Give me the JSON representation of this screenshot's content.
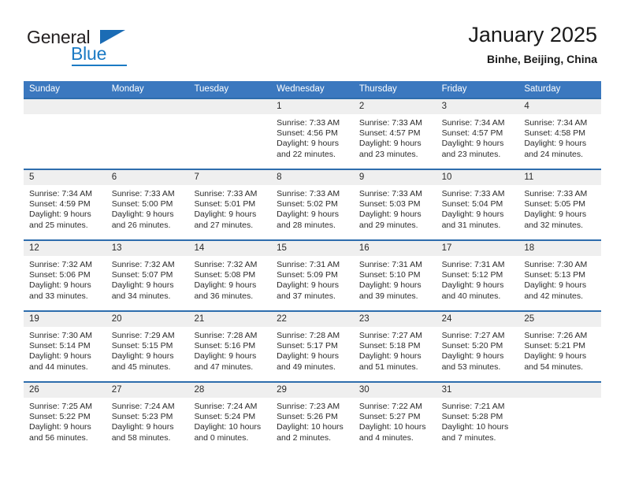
{
  "brand": {
    "name_part1": "General",
    "name_part2": "Blue"
  },
  "header": {
    "title": "January 2025",
    "location": "Binhe, Beijing, China"
  },
  "colors": {
    "header_blue": "#3b78bf",
    "row_divider_blue": "#2e6dad",
    "daynum_band": "#efefef",
    "brand_blue": "#1b7ac4"
  },
  "weekdays": [
    "Sunday",
    "Monday",
    "Tuesday",
    "Wednesday",
    "Thursday",
    "Friday",
    "Saturday"
  ],
  "weeks": [
    [
      {
        "day": "",
        "sunrise": "",
        "sunset": "",
        "daylight": ""
      },
      {
        "day": "",
        "sunrise": "",
        "sunset": "",
        "daylight": ""
      },
      {
        "day": "",
        "sunrise": "",
        "sunset": "",
        "daylight": ""
      },
      {
        "day": "1",
        "sunrise": "Sunrise: 7:33 AM",
        "sunset": "Sunset: 4:56 PM",
        "daylight": "Daylight: 9 hours and 22 minutes."
      },
      {
        "day": "2",
        "sunrise": "Sunrise: 7:33 AM",
        "sunset": "Sunset: 4:57 PM",
        "daylight": "Daylight: 9 hours and 23 minutes."
      },
      {
        "day": "3",
        "sunrise": "Sunrise: 7:34 AM",
        "sunset": "Sunset: 4:57 PM",
        "daylight": "Daylight: 9 hours and 23 minutes."
      },
      {
        "day": "4",
        "sunrise": "Sunrise: 7:34 AM",
        "sunset": "Sunset: 4:58 PM",
        "daylight": "Daylight: 9 hours and 24 minutes."
      }
    ],
    [
      {
        "day": "5",
        "sunrise": "Sunrise: 7:34 AM",
        "sunset": "Sunset: 4:59 PM",
        "daylight": "Daylight: 9 hours and 25 minutes."
      },
      {
        "day": "6",
        "sunrise": "Sunrise: 7:33 AM",
        "sunset": "Sunset: 5:00 PM",
        "daylight": "Daylight: 9 hours and 26 minutes."
      },
      {
        "day": "7",
        "sunrise": "Sunrise: 7:33 AM",
        "sunset": "Sunset: 5:01 PM",
        "daylight": "Daylight: 9 hours and 27 minutes."
      },
      {
        "day": "8",
        "sunrise": "Sunrise: 7:33 AM",
        "sunset": "Sunset: 5:02 PM",
        "daylight": "Daylight: 9 hours and 28 minutes."
      },
      {
        "day": "9",
        "sunrise": "Sunrise: 7:33 AM",
        "sunset": "Sunset: 5:03 PM",
        "daylight": "Daylight: 9 hours and 29 minutes."
      },
      {
        "day": "10",
        "sunrise": "Sunrise: 7:33 AM",
        "sunset": "Sunset: 5:04 PM",
        "daylight": "Daylight: 9 hours and 31 minutes."
      },
      {
        "day": "11",
        "sunrise": "Sunrise: 7:33 AM",
        "sunset": "Sunset: 5:05 PM",
        "daylight": "Daylight: 9 hours and 32 minutes."
      }
    ],
    [
      {
        "day": "12",
        "sunrise": "Sunrise: 7:32 AM",
        "sunset": "Sunset: 5:06 PM",
        "daylight": "Daylight: 9 hours and 33 minutes."
      },
      {
        "day": "13",
        "sunrise": "Sunrise: 7:32 AM",
        "sunset": "Sunset: 5:07 PM",
        "daylight": "Daylight: 9 hours and 34 minutes."
      },
      {
        "day": "14",
        "sunrise": "Sunrise: 7:32 AM",
        "sunset": "Sunset: 5:08 PM",
        "daylight": "Daylight: 9 hours and 36 minutes."
      },
      {
        "day": "15",
        "sunrise": "Sunrise: 7:31 AM",
        "sunset": "Sunset: 5:09 PM",
        "daylight": "Daylight: 9 hours and 37 minutes."
      },
      {
        "day": "16",
        "sunrise": "Sunrise: 7:31 AM",
        "sunset": "Sunset: 5:10 PM",
        "daylight": "Daylight: 9 hours and 39 minutes."
      },
      {
        "day": "17",
        "sunrise": "Sunrise: 7:31 AM",
        "sunset": "Sunset: 5:12 PM",
        "daylight": "Daylight: 9 hours and 40 minutes."
      },
      {
        "day": "18",
        "sunrise": "Sunrise: 7:30 AM",
        "sunset": "Sunset: 5:13 PM",
        "daylight": "Daylight: 9 hours and 42 minutes."
      }
    ],
    [
      {
        "day": "19",
        "sunrise": "Sunrise: 7:30 AM",
        "sunset": "Sunset: 5:14 PM",
        "daylight": "Daylight: 9 hours and 44 minutes."
      },
      {
        "day": "20",
        "sunrise": "Sunrise: 7:29 AM",
        "sunset": "Sunset: 5:15 PM",
        "daylight": "Daylight: 9 hours and 45 minutes."
      },
      {
        "day": "21",
        "sunrise": "Sunrise: 7:28 AM",
        "sunset": "Sunset: 5:16 PM",
        "daylight": "Daylight: 9 hours and 47 minutes."
      },
      {
        "day": "22",
        "sunrise": "Sunrise: 7:28 AM",
        "sunset": "Sunset: 5:17 PM",
        "daylight": "Daylight: 9 hours and 49 minutes."
      },
      {
        "day": "23",
        "sunrise": "Sunrise: 7:27 AM",
        "sunset": "Sunset: 5:18 PM",
        "daylight": "Daylight: 9 hours and 51 minutes."
      },
      {
        "day": "24",
        "sunrise": "Sunrise: 7:27 AM",
        "sunset": "Sunset: 5:20 PM",
        "daylight": "Daylight: 9 hours and 53 minutes."
      },
      {
        "day": "25",
        "sunrise": "Sunrise: 7:26 AM",
        "sunset": "Sunset: 5:21 PM",
        "daylight": "Daylight: 9 hours and 54 minutes."
      }
    ],
    [
      {
        "day": "26",
        "sunrise": "Sunrise: 7:25 AM",
        "sunset": "Sunset: 5:22 PM",
        "daylight": "Daylight: 9 hours and 56 minutes."
      },
      {
        "day": "27",
        "sunrise": "Sunrise: 7:24 AM",
        "sunset": "Sunset: 5:23 PM",
        "daylight": "Daylight: 9 hours and 58 minutes."
      },
      {
        "day": "28",
        "sunrise": "Sunrise: 7:24 AM",
        "sunset": "Sunset: 5:24 PM",
        "daylight": "Daylight: 10 hours and 0 minutes."
      },
      {
        "day": "29",
        "sunrise": "Sunrise: 7:23 AM",
        "sunset": "Sunset: 5:26 PM",
        "daylight": "Daylight: 10 hours and 2 minutes."
      },
      {
        "day": "30",
        "sunrise": "Sunrise: 7:22 AM",
        "sunset": "Sunset: 5:27 PM",
        "daylight": "Daylight: 10 hours and 4 minutes."
      },
      {
        "day": "31",
        "sunrise": "Sunrise: 7:21 AM",
        "sunset": "Sunset: 5:28 PM",
        "daylight": "Daylight: 10 hours and 7 minutes."
      },
      {
        "day": "",
        "sunrise": "",
        "sunset": "",
        "daylight": ""
      }
    ]
  ]
}
